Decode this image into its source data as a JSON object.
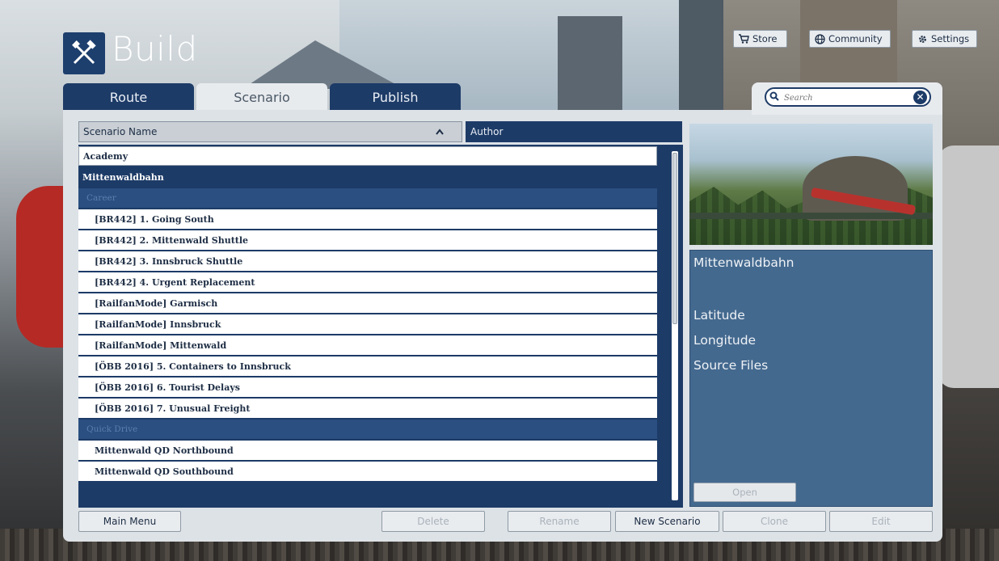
{
  "header": {
    "title": "Build",
    "top_buttons": [
      {
        "label": "Store",
        "icon": "cart-icon"
      },
      {
        "label": "Community",
        "icon": "globe-icon"
      },
      {
        "label": "Settings",
        "icon": "gear-icon"
      }
    ]
  },
  "tabs": [
    {
      "label": "Route",
      "active": false
    },
    {
      "label": "Scenario",
      "active": true
    },
    {
      "label": "Publish",
      "active": false
    }
  ],
  "search": {
    "placeholder": "Search",
    "value": ""
  },
  "columns": {
    "name": "Scenario Name",
    "author": "Author",
    "sort_direction": "ascending"
  },
  "list": {
    "rows": [
      {
        "type": "top",
        "label": "Academy"
      },
      {
        "type": "selected",
        "label": "Mittenwaldbahn"
      },
      {
        "type": "category",
        "label": "Career"
      },
      {
        "type": "item",
        "label": "[BR442] 1. Going South"
      },
      {
        "type": "item",
        "label": "[BR442] 2. Mittenwald Shuttle"
      },
      {
        "type": "item",
        "label": "[BR442] 3. Innsbruck Shuttle"
      },
      {
        "type": "item",
        "label": "[BR442] 4. Urgent Replacement"
      },
      {
        "type": "item",
        "label": "[RailfanMode] Garmisch"
      },
      {
        "type": "item",
        "label": "[RailfanMode] Innsbruck"
      },
      {
        "type": "item",
        "label": "[RailfanMode] Mittenwald"
      },
      {
        "type": "item",
        "label": "[ÖBB 2016] 5. Containers to Innsbruck"
      },
      {
        "type": "item",
        "label": "[ÖBB 2016] 6. Tourist Delays"
      },
      {
        "type": "item",
        "label": "[ÖBB 2016] 7. Unusual Freight"
      },
      {
        "type": "category",
        "label": "Quick Drive"
      },
      {
        "type": "item",
        "label": "Mittenwald QD Northbound"
      },
      {
        "type": "item",
        "label": "Mittenwald QD Southbound"
      }
    ]
  },
  "details": {
    "name": "Mittenwaldbahn",
    "latitude_label": "Latitude",
    "longitude_label": "Longitude",
    "source_files_label": "Source Files",
    "open_label": "Open"
  },
  "bottom": {
    "main_menu": "Main Menu",
    "delete": "Delete",
    "rename": "Rename",
    "new_scenario": "New Scenario",
    "clone": "Clone",
    "edit": "Edit"
  },
  "colors": {
    "accent": "#1d3b67",
    "panel": "#dde2e6",
    "info_panel": "#44698f"
  }
}
